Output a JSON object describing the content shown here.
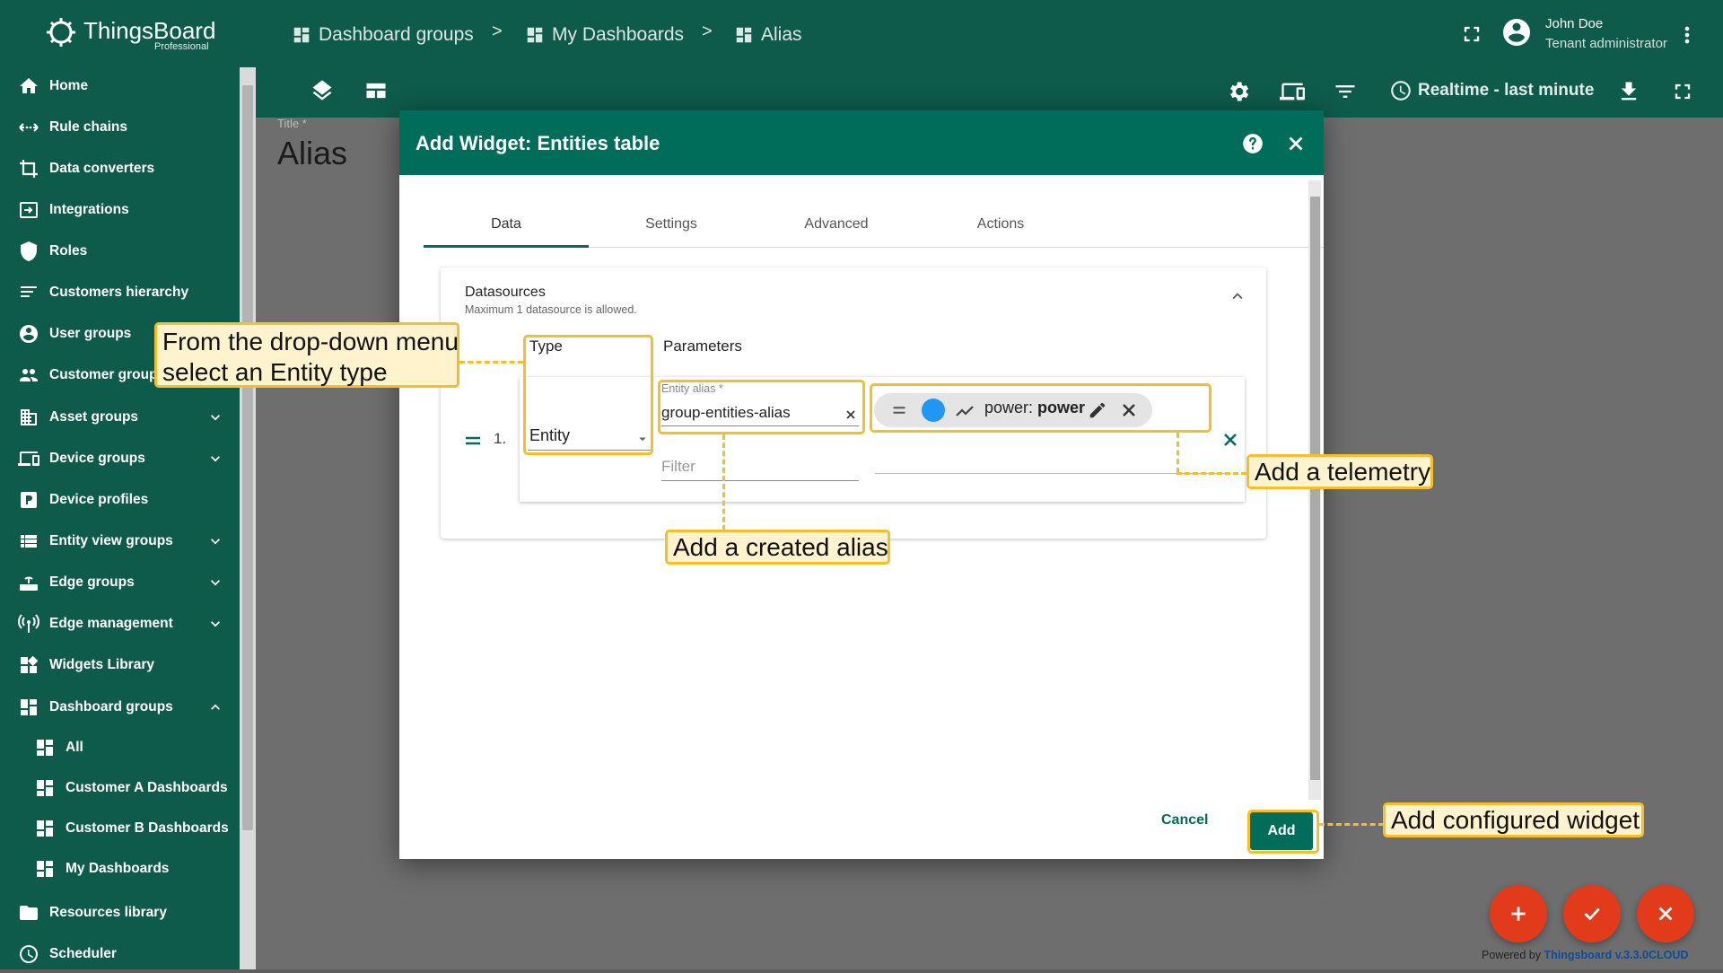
{
  "brand": {
    "name": "ThingsBoard",
    "edition": "Professional"
  },
  "breadcrumb": [
    {
      "label": "Dashboard groups"
    },
    {
      "label": "My Dashboards"
    },
    {
      "label": "Alias"
    }
  ],
  "breadcrumb_separator": ">",
  "user": {
    "name": "John Doe",
    "role": "Tenant administrator"
  },
  "toolbar": {
    "timewindow": "Realtime - last minute"
  },
  "sidebar": [
    {
      "label": "Home",
      "icon": "home-icon"
    },
    {
      "label": "Rule chains",
      "icon": "rule-chains-icon"
    },
    {
      "label": "Data converters",
      "icon": "data-converters-icon"
    },
    {
      "label": "Integrations",
      "icon": "integrations-icon"
    },
    {
      "label": "Roles",
      "icon": "roles-icon"
    },
    {
      "label": "Customers hierarchy",
      "icon": "hierarchy-icon"
    },
    {
      "label": "User groups",
      "icon": "user-groups-icon"
    },
    {
      "label": "Customer groups",
      "icon": "customer-groups-icon"
    },
    {
      "label": "Asset groups",
      "icon": "asset-groups-icon",
      "expand": "down"
    },
    {
      "label": "Device groups",
      "icon": "device-groups-icon",
      "expand": "down"
    },
    {
      "label": "Device profiles",
      "icon": "device-profiles-icon"
    },
    {
      "label": "Entity view groups",
      "icon": "entity-view-groups-icon",
      "expand": "down"
    },
    {
      "label": "Edge groups",
      "icon": "edge-groups-icon",
      "expand": "down"
    },
    {
      "label": "Edge management",
      "icon": "edge-management-icon",
      "expand": "down"
    },
    {
      "label": "Widgets Library",
      "icon": "widgets-library-icon"
    },
    {
      "label": "Dashboard groups",
      "icon": "dashboard-groups-icon",
      "expand": "up"
    },
    {
      "label": "All",
      "icon": "dashboard-icon",
      "sub": true
    },
    {
      "label": "Customer A Dashboards",
      "icon": "dashboard-icon",
      "sub": true
    },
    {
      "label": "Customer B Dashboards",
      "icon": "dashboard-icon",
      "sub": true
    },
    {
      "label": "My Dashboards",
      "icon": "dashboard-icon",
      "sub": true
    },
    {
      "label": "Resources library",
      "icon": "folder-icon"
    },
    {
      "label": "Scheduler",
      "icon": "scheduler-icon"
    }
  ],
  "page": {
    "title_label": "Title *",
    "title_value": "Alias"
  },
  "dialog": {
    "title": "Add Widget: Entities table",
    "tabs": [
      "Data",
      "Settings",
      "Advanced",
      "Actions"
    ],
    "active_tab": "Data",
    "datasources": {
      "title": "Datasources",
      "subtitle": "Maximum 1 datasource is allowed.",
      "col_type": "Type",
      "col_params": "Parameters",
      "row_index": "1.",
      "type_value": "Entity",
      "entity_alias_label": "Entity alias *",
      "entity_alias_value": "group-entities-alias",
      "filter_placeholder": "Filter",
      "key_chip": {
        "prefix": "power:",
        "name": "power",
        "color": "#2196f3"
      }
    },
    "cancel": "Cancel",
    "add": "Add"
  },
  "callouts": {
    "type": "From the drop-down menu select an Entity type",
    "type_line1": "From the drop-down menu",
    "type_line2": "select an Entity type",
    "alias": "Add a created alias",
    "telemetry": "Add a telemetry",
    "add": "Add configured widget"
  },
  "fabs": [
    {
      "icon": "plus-icon"
    },
    {
      "icon": "check-icon"
    },
    {
      "icon": "close-icon"
    }
  ],
  "footer": {
    "prefix": "Powered by",
    "link": "Thingsboard v.3.3.0CLOUD"
  },
  "colors": {
    "primary": "#0f5b4b",
    "dialog_header": "#006d5b",
    "accent": "#e23b1c",
    "callout": "#f6be2c"
  }
}
